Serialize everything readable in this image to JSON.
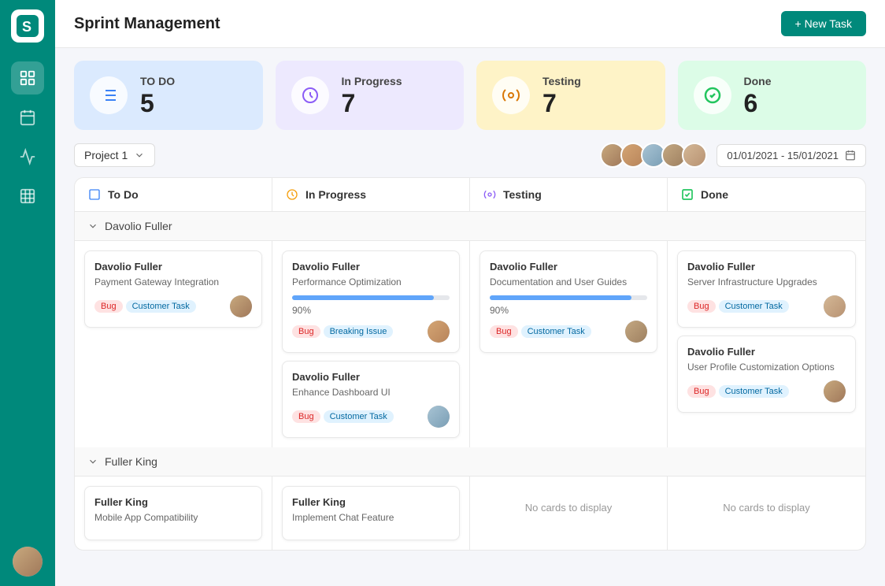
{
  "app": {
    "logo": "S",
    "title": "Sprint Management"
  },
  "header": {
    "title": "Sprint Management",
    "new_task_btn": "+ New Task"
  },
  "stats": [
    {
      "id": "todo",
      "label": "TO DO",
      "count": "5",
      "icon": "list-icon",
      "color": "todo"
    },
    {
      "id": "inprogress",
      "label": "In Progress",
      "count": "7",
      "icon": "spinner-icon",
      "color": "inprogress"
    },
    {
      "id": "testing",
      "label": "Testing",
      "count": "7",
      "icon": "gear-icon",
      "color": "testing"
    },
    {
      "id": "done",
      "label": "Done",
      "count": "6",
      "icon": "check-icon",
      "color": "done"
    }
  ],
  "toolbar": {
    "project_label": "Project 1",
    "date_range": "01/01/2021 - 15/01/2021"
  },
  "columns": [
    {
      "id": "todo",
      "label": "To Do",
      "color": "#3b82f6"
    },
    {
      "id": "inprogress",
      "label": "In Progress",
      "color": "#f59e0b"
    },
    {
      "id": "testing",
      "label": "Testing",
      "color": "#8b5cf6"
    },
    {
      "id": "done",
      "label": "Done",
      "color": "#22c55e"
    }
  ],
  "groups": [
    {
      "id": "davolio",
      "name": "Davolio Fuller",
      "expanded": true,
      "cards": {
        "todo": [
          {
            "assignee": "Davolio Fuller",
            "title": "Payment Gateway Integration",
            "tags": [
              "Bug",
              "Customer Task"
            ],
            "avatar": 1
          }
        ],
        "inprogress": [
          {
            "assignee": "Davolio Fuller",
            "title": "Performance Optimization",
            "progress": 90,
            "tags": [
              "Bug",
              "Breaking Issue"
            ],
            "avatar": 2
          },
          {
            "assignee": "Davolio Fuller",
            "title": "Enhance Dashboard UI",
            "tags": [
              "Bug",
              "Customer Task"
            ],
            "avatar": 3
          }
        ],
        "testing": [
          {
            "assignee": "Davolio Fuller",
            "title": "Documentation and User Guides",
            "progress": 90,
            "tags": [
              "Bug",
              "Customer Task"
            ],
            "avatar": 4
          }
        ],
        "done": [
          {
            "assignee": "Davolio Fuller",
            "title": "Server Infrastructure Upgrades",
            "tags": [
              "Bug",
              "Customer Task"
            ],
            "avatar": 5
          },
          {
            "assignee": "Davolio Fuller",
            "title": "User Profile Customization Options",
            "tags": [
              "Bug",
              "Customer Task"
            ],
            "avatar": 1
          }
        ]
      }
    },
    {
      "id": "fuller-king",
      "name": "Fuller King",
      "expanded": true,
      "cards": {
        "todo": [
          {
            "assignee": "Fuller King",
            "title": "Mobile App Compatibility",
            "tags": [],
            "avatar": 2
          }
        ],
        "inprogress": [
          {
            "assignee": "Fuller King",
            "title": "Implement Chat Feature",
            "tags": [],
            "avatar": 3
          }
        ],
        "testing": [],
        "done": []
      }
    }
  ],
  "no_cards_text": "No cards to display"
}
